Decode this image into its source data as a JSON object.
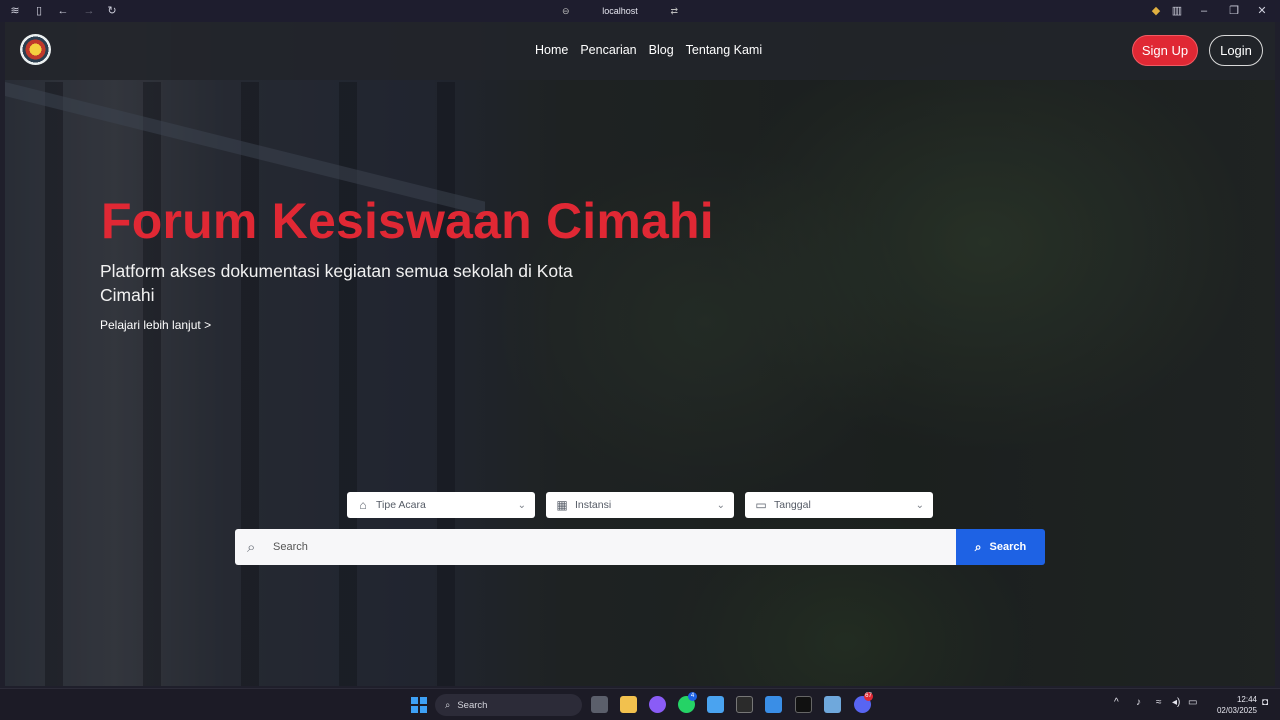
{
  "browser": {
    "url": "localhost",
    "icons": [
      "app-menu-icon",
      "sidebar-icon",
      "back-icon",
      "forward-icon",
      "reload-icon",
      "site-info-icon",
      "tab-swap-icon",
      "extension-icon",
      "split-view-icon",
      "minimize-icon",
      "maximize-icon",
      "close-icon"
    ]
  },
  "navbar": {
    "logo_alt": "Forum Kesiswaan Cimahi logo",
    "links": [
      "Home",
      "Pencarian",
      "Blog",
      "Tentang Kami"
    ],
    "signup_label": "Sign Up",
    "login_label": "Login"
  },
  "hero": {
    "title": "Forum Kesiswaan Cimahi",
    "subtitle": "Platform akses dokumentasi kegiatan semua sekolah di Kota Cimahi",
    "link": "Pelajari lebih lanjut >"
  },
  "search": {
    "filters": [
      {
        "label": "Tipe Acara",
        "icon": "tag-icon"
      },
      {
        "label": "Instansi",
        "icon": "building-icon"
      },
      {
        "label": "Tanggal",
        "icon": "calendar-icon"
      }
    ],
    "placeholder": "Search",
    "button_label": "Search"
  },
  "taskbar": {
    "search_label": "Search",
    "time": "12:44",
    "date": "02/03/2025",
    "badges": {
      "whatsapp": "4",
      "discord": "67"
    }
  },
  "colors": {
    "accent_red": "#e02834",
    "search_blue": "#1e62e4"
  }
}
